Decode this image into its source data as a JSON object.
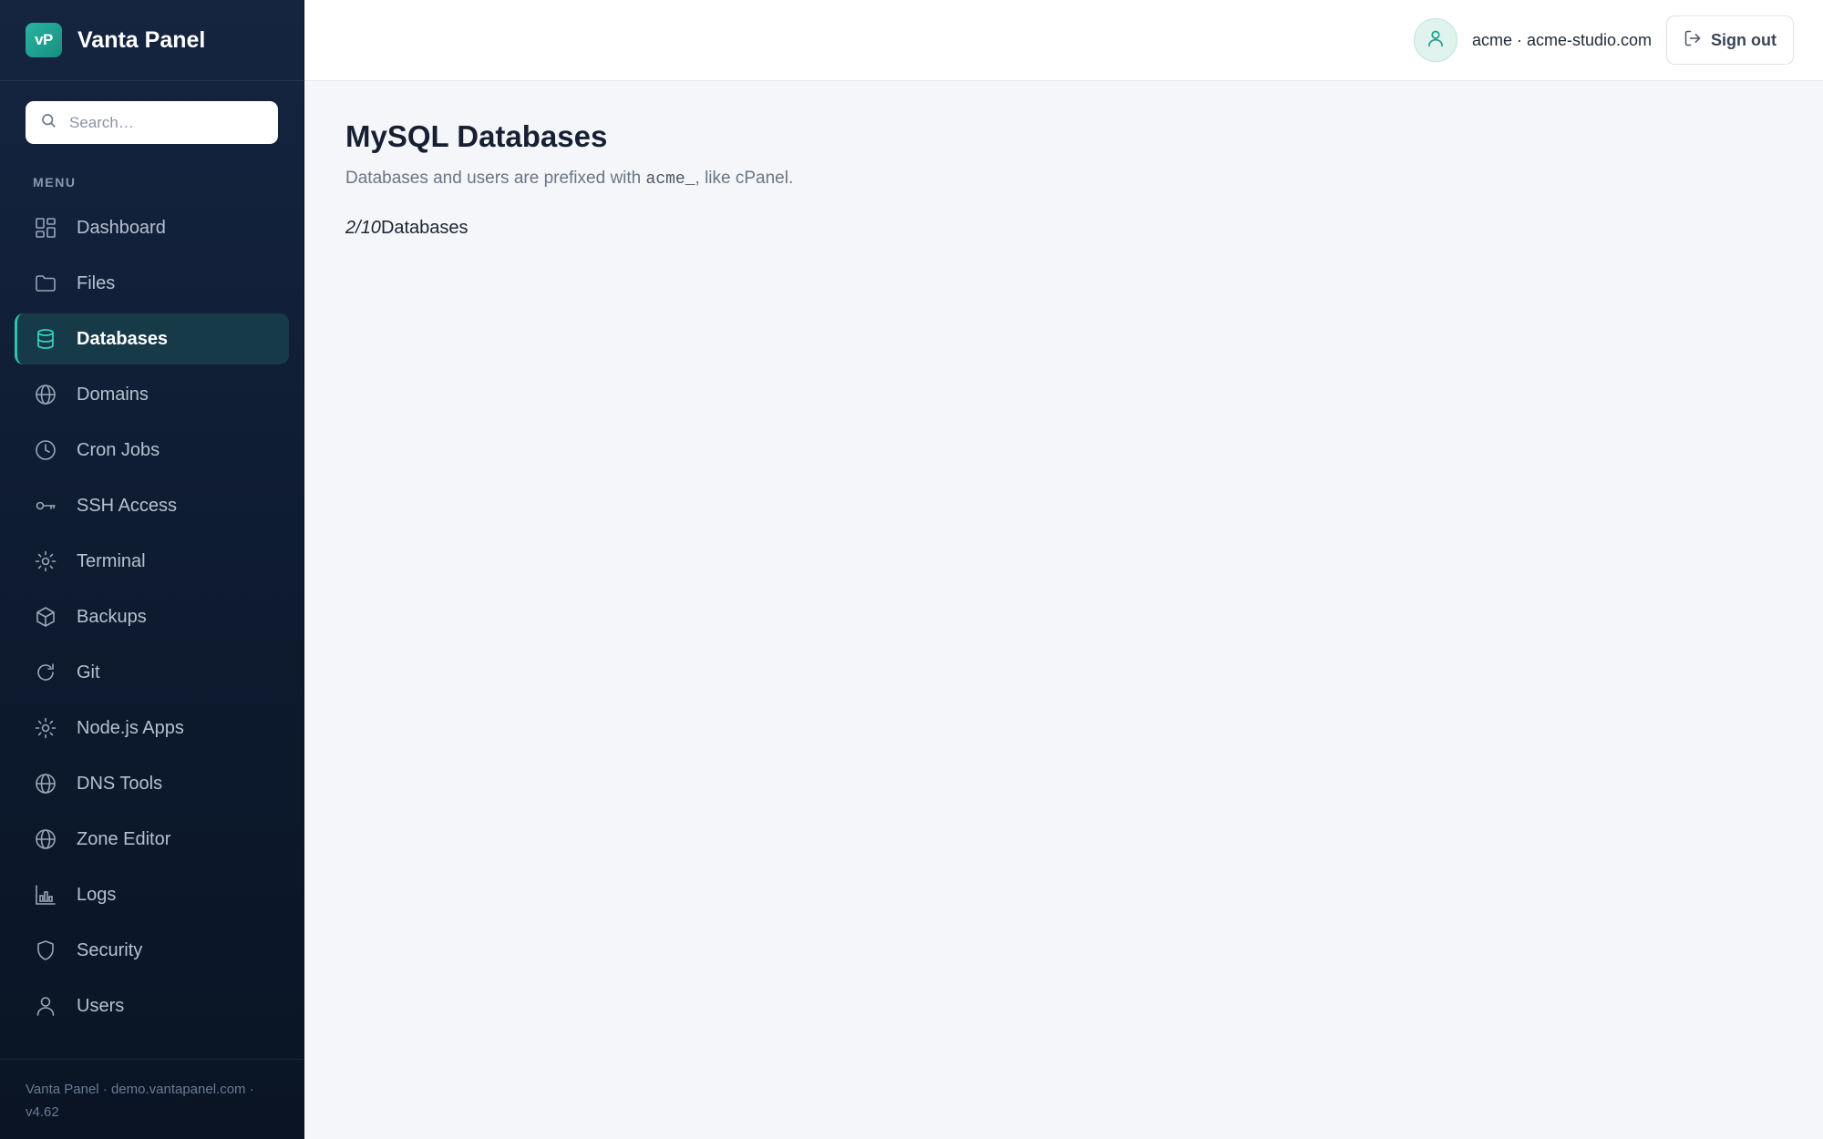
{
  "brand": {
    "logo_text": "vP",
    "name": "Vanta Panel"
  },
  "search": {
    "placeholder": "Search…"
  },
  "menu_label": "MENU",
  "nav": [
    {
      "label": "Dashboard",
      "icon": "grid-icon",
      "active": false
    },
    {
      "label": "Files",
      "icon": "folder-icon",
      "active": false
    },
    {
      "label": "Databases",
      "icon": "database-icon",
      "active": true
    },
    {
      "label": "Domains",
      "icon": "globe-icon",
      "active": false
    },
    {
      "label": "Cron Jobs",
      "icon": "clock-icon",
      "active": false
    },
    {
      "label": "SSH Access",
      "icon": "key-icon",
      "active": false
    },
    {
      "label": "Terminal",
      "icon": "sun-icon",
      "active": false
    },
    {
      "label": "Backups",
      "icon": "box-icon",
      "active": false
    },
    {
      "label": "Git",
      "icon": "refresh-icon",
      "active": false
    },
    {
      "label": "Node.js Apps",
      "icon": "sun-icon",
      "active": false
    },
    {
      "label": "DNS Tools",
      "icon": "globe-icon",
      "active": false
    },
    {
      "label": "Zone Editor",
      "icon": "globe-icon",
      "active": false
    },
    {
      "label": "Logs",
      "icon": "bar-chart-icon",
      "active": false
    },
    {
      "label": "Security",
      "icon": "shield-icon",
      "active": false
    },
    {
      "label": "Users",
      "icon": "user-icon",
      "active": false
    }
  ],
  "footer": {
    "text": "Vanta Panel · demo.vantapanel.com · v4.62"
  },
  "topbar": {
    "user": "acme · acme-studio.com",
    "signout_label": "Sign out"
  },
  "page": {
    "title": "MySQL Databases",
    "subtitle_before": "Databases and users are prefixed with ",
    "subtitle_code": "acme_",
    "subtitle_after": ", like cPanel.",
    "quota_used": "2",
    "quota_total": "10",
    "quota_label": "Databases"
  },
  "colors": {
    "accent": "#2bb3a0",
    "sidebar_bg": "#0d1a2f",
    "active_bg": "#173a48"
  }
}
